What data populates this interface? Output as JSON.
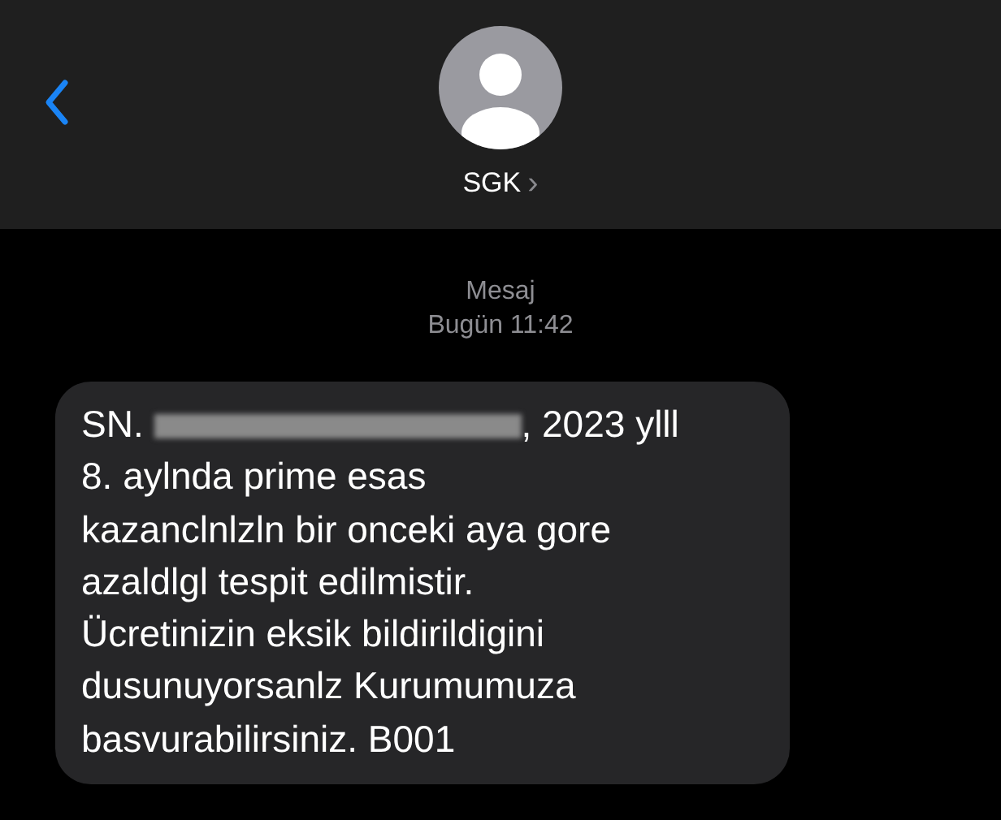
{
  "header": {
    "back": true,
    "contact": "SGK",
    "chevron": "›"
  },
  "timestamp": {
    "service": "Mesaj",
    "time": "Bugün 11:42"
  },
  "message": {
    "parts": [
      {
        "kind": "text",
        "text": "SN. "
      },
      {
        "kind": "redacted"
      },
      {
        "kind": "text",
        "text": ", 2023 ylll\n8. aylnda prime esas\nkazanclnlzln bir onceki aya gore\nazaldlgl tespit edilmistir.\nÜcretinizin eksik bildirildigini\ndusunuyorsanlz Kurumumuza\nbasvurabilirsiniz. B001"
      }
    ]
  }
}
